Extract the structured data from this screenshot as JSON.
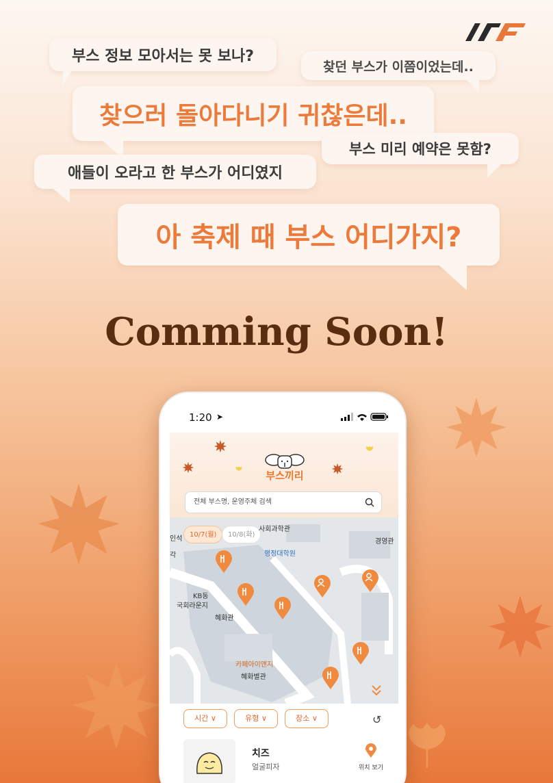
{
  "bubbles": {
    "b1": "부스 정보 모아서는 못 보나?",
    "b2": "찾던 부스가 이쯤이었는데..",
    "b3": "찾으러 돌아다니기 귀찮은데..",
    "b4": "부스 미리 예약은 못함?",
    "b5": "애들이 오라고 한 부스가 어디였지",
    "b6": "아 축제 때 부스 어디가지?"
  },
  "headline": "Comming Soon!",
  "phone": {
    "status": {
      "time": "1:20"
    },
    "app": {
      "brand": "부스끼리"
    },
    "search": {
      "placeholder": "전체 부스명, 운영주체 검색"
    },
    "dates": {
      "selected": "10/7(월)",
      "other": "10/8(화)"
    },
    "map_labels": {
      "social": "사회과학관",
      "admin": "행정대학원",
      "inseok": "인석",
      "gyeongyeong": "경영관",
      "kb": "KB동",
      "lounge": "국회라운지",
      "hyehwa": "혜화관",
      "cafe": "카페아이앤지",
      "hyehwa_annex": "혜화별관",
      "left_edge": "각"
    },
    "filters": {
      "time": "시간",
      "type": "유형",
      "place": "장소"
    },
    "card": {
      "name": "치즈",
      "sub": "얼굴피자",
      "loc_label": "위치 보기"
    }
  },
  "colors": {
    "accent": "#ec7a3a",
    "headline": "#5a2d10"
  }
}
